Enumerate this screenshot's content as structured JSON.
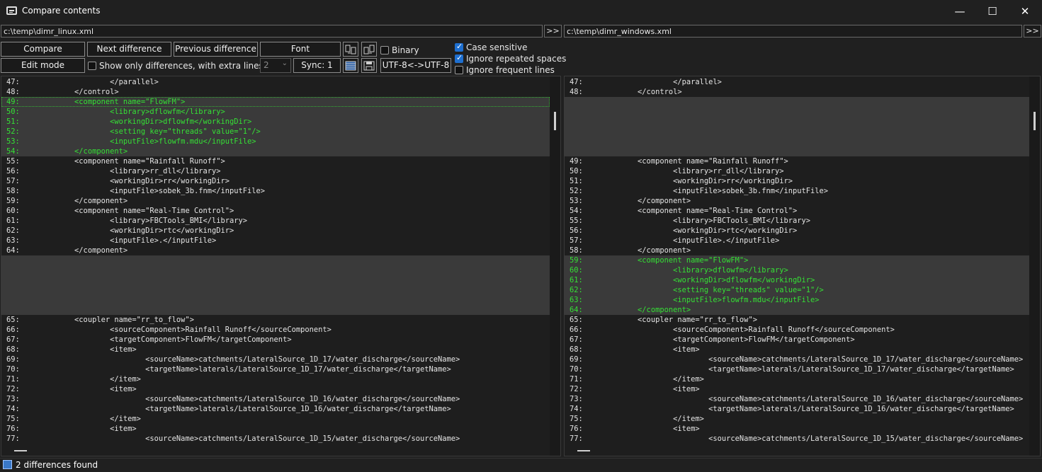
{
  "window": {
    "title": "Compare contents",
    "minimize_glyph": "—",
    "maximize_glyph": "☐",
    "close_glyph": "✕",
    "icon": "compare-files-icon"
  },
  "paths": {
    "left": "c:\\temp\\dimr_linux.xml",
    "right": "c:\\temp\\dimr_windows.xml",
    "browse_label": ">>"
  },
  "toolbar": {
    "compare": "Compare",
    "next_difference": "Next difference",
    "previous_difference": "Previous difference",
    "font": "Font",
    "edit_mode": "Edit mode",
    "show_only_differences": "Show only differences, with extra lines:",
    "extra_lines_value": "2",
    "sync": "Sync: 1",
    "encoding": "UTF-8<->UTF-8",
    "binary": "Binary",
    "case_sensitive": "Case sensitive",
    "ignore_repeated_spaces": "Ignore repeated spaces",
    "ignore_frequent_lines": "Ignore frequent lines",
    "states": {
      "binary": false,
      "show_only_differences": false,
      "case_sensitive": true,
      "ignore_repeated_spaces": true,
      "ignore_frequent_lines": false
    }
  },
  "left_lines": [
    {
      "n": "47:",
      "t": "\t\t</parallel>",
      "k": "n"
    },
    {
      "n": "48:",
      "t": "\t</control>",
      "k": "n"
    },
    {
      "n": "49:",
      "t": "\t<component name=\"FlowFM\">",
      "k": "d"
    },
    {
      "n": "50:",
      "t": "\t\t<library>dflowfm</library>",
      "k": "d"
    },
    {
      "n": "51:",
      "t": "\t\t<workingDir>dflowfm</workingDir>",
      "k": "d"
    },
    {
      "n": "52:",
      "t": "\t\t<setting key=\"threads\" value=\"1\"/>",
      "k": "d"
    },
    {
      "n": "53:",
      "t": "\t\t<inputFile>flowfm.mdu</inputFile>",
      "k": "d"
    },
    {
      "n": "54:",
      "t": "\t</component>",
      "k": "d"
    },
    {
      "n": "55:",
      "t": "\t<component name=\"Rainfall Runoff\">",
      "k": "n"
    },
    {
      "n": "56:",
      "t": "\t\t<library>rr_dll</library>",
      "k": "n"
    },
    {
      "n": "57:",
      "t": "\t\t<workingDir>rr</workingDir>",
      "k": "n"
    },
    {
      "n": "58:",
      "t": "\t\t<inputFile>sobek_3b.fnm</inputFile>",
      "k": "n"
    },
    {
      "n": "59:",
      "t": "\t</component>",
      "k": "n"
    },
    {
      "n": "60:",
      "t": "\t<component name=\"Real-Time Control\">",
      "k": "n"
    },
    {
      "n": "61:",
      "t": "\t\t<library>FBCTools_BMI</library>",
      "k": "n"
    },
    {
      "n": "62:",
      "t": "\t\t<workingDir>rtc</workingDir>",
      "k": "n"
    },
    {
      "n": "63:",
      "t": "\t\t<inputFile>.</inputFile>",
      "k": "n"
    },
    {
      "n": "64:",
      "t": "\t</component>",
      "k": "n"
    },
    {
      "n": "",
      "t": "",
      "k": "p"
    },
    {
      "n": "",
      "t": "",
      "k": "p"
    },
    {
      "n": "",
      "t": "",
      "k": "p"
    },
    {
      "n": "",
      "t": "",
      "k": "p"
    },
    {
      "n": "",
      "t": "",
      "k": "p"
    },
    {
      "n": "",
      "t": "",
      "k": "p"
    },
    {
      "n": "65:",
      "t": "\t<coupler name=\"rr_to_flow\">",
      "k": "n"
    },
    {
      "n": "66:",
      "t": "\t\t<sourceComponent>Rainfall Runoff</sourceComponent>",
      "k": "n"
    },
    {
      "n": "67:",
      "t": "\t\t<targetComponent>FlowFM</targetComponent>",
      "k": "n"
    },
    {
      "n": "68:",
      "t": "\t\t<item>",
      "k": "n"
    },
    {
      "n": "69:",
      "t": "\t\t\t<sourceName>catchments/LateralSource_1D_17/water_discharge</sourceName>",
      "k": "n"
    },
    {
      "n": "70:",
      "t": "\t\t\t<targetName>laterals/LateralSource_1D_17/water_discharge</targetName>",
      "k": "n"
    },
    {
      "n": "71:",
      "t": "\t\t</item>",
      "k": "n"
    },
    {
      "n": "72:",
      "t": "\t\t<item>",
      "k": "n"
    },
    {
      "n": "73:",
      "t": "\t\t\t<sourceName>catchments/LateralSource_1D_16/water_discharge</sourceName>",
      "k": "n"
    },
    {
      "n": "74:",
      "t": "\t\t\t<targetName>laterals/LateralSource_1D_16/water_discharge</targetName>",
      "k": "n"
    },
    {
      "n": "75:",
      "t": "\t\t</item>",
      "k": "n"
    },
    {
      "n": "76:",
      "t": "\t\t<item>",
      "k": "n"
    },
    {
      "n": "77:",
      "t": "\t\t\t<sourceName>catchments/LateralSource_1D_15/water_discharge</sourceName>",
      "k": "n"
    }
  ],
  "right_lines": [
    {
      "n": "47:",
      "t": "\t\t</parallel>",
      "k": "n"
    },
    {
      "n": "48:",
      "t": "\t</control>",
      "k": "n"
    },
    {
      "n": "",
      "t": "",
      "k": "p"
    },
    {
      "n": "",
      "t": "",
      "k": "p"
    },
    {
      "n": "",
      "t": "",
      "k": "p"
    },
    {
      "n": "",
      "t": "",
      "k": "p"
    },
    {
      "n": "",
      "t": "",
      "k": "p"
    },
    {
      "n": "",
      "t": "",
      "k": "p"
    },
    {
      "n": "49:",
      "t": "\t<component name=\"Rainfall Runoff\">",
      "k": "n"
    },
    {
      "n": "50:",
      "t": "\t\t<library>rr_dll</library>",
      "k": "n"
    },
    {
      "n": "51:",
      "t": "\t\t<workingDir>rr</workingDir>",
      "k": "n"
    },
    {
      "n": "52:",
      "t": "\t\t<inputFile>sobek_3b.fnm</inputFile>",
      "k": "n"
    },
    {
      "n": "53:",
      "t": "\t</component>",
      "k": "n"
    },
    {
      "n": "54:",
      "t": "\t<component name=\"Real-Time Control\">",
      "k": "n"
    },
    {
      "n": "55:",
      "t": "\t\t<library>FBCTools_BMI</library>",
      "k": "n"
    },
    {
      "n": "56:",
      "t": "\t\t<workingDir>rtc</workingDir>",
      "k": "n"
    },
    {
      "n": "57:",
      "t": "\t\t<inputFile>.</inputFile>",
      "k": "n"
    },
    {
      "n": "58:",
      "t": "\t</component>",
      "k": "n"
    },
    {
      "n": "59:",
      "t": "\t<component name=\"FlowFM\">",
      "k": "d"
    },
    {
      "n": "60:",
      "t": "\t\t<library>dflowfm</library>",
      "k": "d"
    },
    {
      "n": "61:",
      "t": "\t\t<workingDir>dflowfm</workingDir>",
      "k": "d"
    },
    {
      "n": "62:",
      "t": "\t\t<setting key=\"threads\" value=\"1\"/>",
      "k": "d"
    },
    {
      "n": "63:",
      "t": "\t\t<inputFile>flowfm.mdu</inputFile>",
      "k": "d"
    },
    {
      "n": "64:",
      "t": "\t</component>",
      "k": "d"
    },
    {
      "n": "65:",
      "t": "\t<coupler name=\"rr_to_flow\">",
      "k": "n"
    },
    {
      "n": "66:",
      "t": "\t\t<sourceComponent>Rainfall Runoff</sourceComponent>",
      "k": "n"
    },
    {
      "n": "67:",
      "t": "\t\t<targetComponent>FlowFM</targetComponent>",
      "k": "n"
    },
    {
      "n": "68:",
      "t": "\t\t<item>",
      "k": "n"
    },
    {
      "n": "69:",
      "t": "\t\t\t<sourceName>catchments/LateralSource_1D_17/water_discharge</sourceName>",
      "k": "n"
    },
    {
      "n": "70:",
      "t": "\t\t\t<targetName>laterals/LateralSource_1D_17/water_discharge</targetName>",
      "k": "n"
    },
    {
      "n": "71:",
      "t": "\t\t</item>",
      "k": "n"
    },
    {
      "n": "72:",
      "t": "\t\t<item>",
      "k": "n"
    },
    {
      "n": "73:",
      "t": "\t\t\t<sourceName>catchments/LateralSource_1D_16/water_discharge</sourceName>",
      "k": "n"
    },
    {
      "n": "74:",
      "t": "\t\t\t<targetName>laterals/LateralSource_1D_16/water_discharge</targetName>",
      "k": "n"
    },
    {
      "n": "75:",
      "t": "\t\t</item>",
      "k": "n"
    },
    {
      "n": "76:",
      "t": "\t\t<item>",
      "k": "n"
    },
    {
      "n": "77:",
      "t": "\t\t\t<sourceName>catchments/LateralSource_1D_15/water_discharge</sourceName>",
      "k": "n"
    }
  ],
  "status": {
    "text": "2 differences found",
    "icon": "panes-icon"
  },
  "colors": {
    "background": "#202020",
    "diff_text": "#35e035",
    "diff_background": "#3a3a3a",
    "checkbox_accent": "#1e6fd0"
  }
}
